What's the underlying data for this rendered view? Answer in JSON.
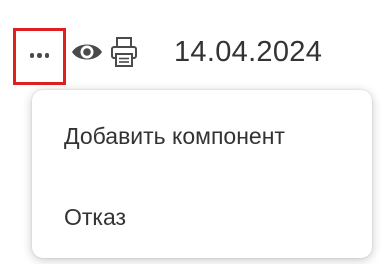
{
  "row": {
    "date": "14.04.2024",
    "actions": {
      "more_icon": "more-horizontal-icon",
      "view_icon": "eye-icon",
      "print_icon": "printer-icon"
    }
  },
  "colors": {
    "highlight": "#e02020",
    "icon": "#4a4a4a",
    "text": "#333333"
  },
  "menu": {
    "items": [
      {
        "label": "Добавить компонент"
      },
      {
        "label": "Отказ"
      }
    ]
  }
}
